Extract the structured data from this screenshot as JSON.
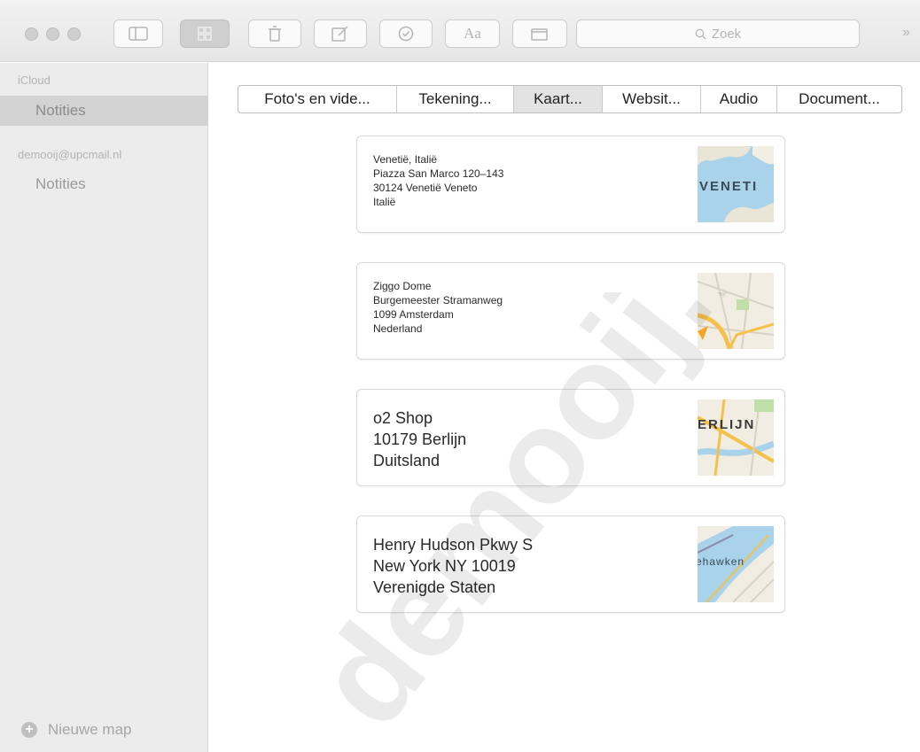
{
  "toolbar": {
    "search_placeholder": "Zoek",
    "overflow_glyph": "»",
    "buttons": [
      "sidebar-toggle-icon",
      "gallery-icon",
      "trash-icon",
      "compose-icon",
      "checklist-icon",
      "font-format-icon",
      "attachment-icon"
    ]
  },
  "sidebar": {
    "accounts": [
      {
        "name": "iCloud",
        "folders": [
          "Notities"
        ]
      },
      {
        "name": "demooij@upcmail.nl",
        "folders": [
          "Notities"
        ]
      }
    ],
    "new_folder": "Nieuwe map"
  },
  "segments": [
    {
      "label": "Foto's en vide...",
      "active": false
    },
    {
      "label": "Tekening...",
      "active": false
    },
    {
      "label": "Kaart...",
      "active": true
    },
    {
      "label": "Websit...",
      "active": false
    },
    {
      "label": "Audio",
      "active": false
    },
    {
      "label": "Document...",
      "active": false
    }
  ],
  "maps": [
    {
      "lines": [
        "Venetië, Italië",
        "Piazza San Marco 120–143",
        "30124 Venetië Veneto",
        "Italië"
      ],
      "thumb_label": "VENETI"
    },
    {
      "lines": [
        "Ziggo Dome",
        "Burgemeester Stramanweg",
        "1099 Amsterdam",
        "Nederland"
      ],
      "thumb_label": ""
    },
    {
      "lines": [
        "o2 Shop",
        "10179 Berlijn",
        "Duitsland"
      ],
      "thumb_label": "ERLIJN"
    },
    {
      "lines": [
        "Henry Hudson Pkwy S",
        "New York NY 10019",
        "Verenigde Staten"
      ],
      "thumb_label": "ehawken"
    }
  ],
  "watermark": "demooij.nl"
}
